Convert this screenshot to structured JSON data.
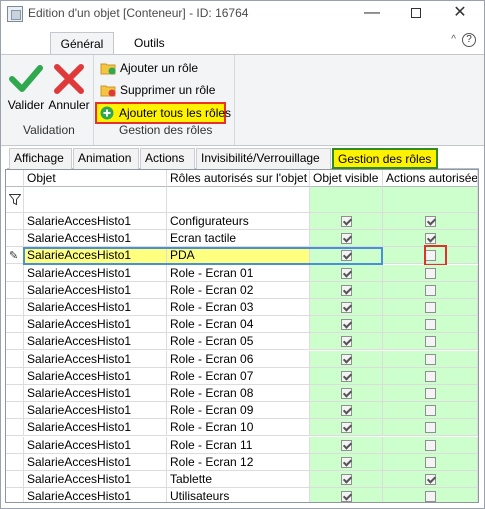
{
  "window": {
    "title": "Edition d'un objet [Conteneur] - ID: 16764",
    "controls": {
      "minimize": "—",
      "maximize": "",
      "close": "✕"
    }
  },
  "ribbon_tabs": {
    "general": "Général",
    "outils": "Outils"
  },
  "ribbon": {
    "validation": {
      "ok_label": "Valider",
      "cancel_label": "Annuler",
      "group_label": "Validation"
    },
    "roles": {
      "add_role": "Ajouter un rôle",
      "delete_role": "Supprimer un rôle",
      "add_all_roles": "Ajouter tous les rôles",
      "group_label": "Gestion des rôles"
    }
  },
  "sub_tabs": [
    {
      "label": "Affichage"
    },
    {
      "label": "Animation"
    },
    {
      "label": "Actions"
    },
    {
      "label": "Invisibilité/Verrouillage"
    },
    {
      "label": "Gestion des rôles"
    }
  ],
  "grid": {
    "headers": {
      "objet": "Objet",
      "roles": "Rôles autorisés sur l'objet",
      "visible": "Objet visible",
      "actions": "Actions autorisées"
    },
    "rows": [
      {
        "objet": "SalarieAccesHisto1",
        "role": "Configurateurs",
        "visible": true,
        "actions": true
      },
      {
        "objet": "SalarieAccesHisto1",
        "role": "Ecran tactile",
        "visible": true,
        "actions": true
      },
      {
        "objet": "SalarieAccesHisto1",
        "role": "PDA",
        "visible": true,
        "actions": false,
        "selected": true
      },
      {
        "objet": "SalarieAccesHisto1",
        "role": "Role - Ecran 01",
        "visible": true,
        "actions": false
      },
      {
        "objet": "SalarieAccesHisto1",
        "role": "Role - Ecran 02",
        "visible": true,
        "actions": false
      },
      {
        "objet": "SalarieAccesHisto1",
        "role": "Role - Ecran 03",
        "visible": true,
        "actions": false
      },
      {
        "objet": "SalarieAccesHisto1",
        "role": "Role - Ecran 04",
        "visible": true,
        "actions": false
      },
      {
        "objet": "SalarieAccesHisto1",
        "role": "Role - Ecran 05",
        "visible": true,
        "actions": false
      },
      {
        "objet": "SalarieAccesHisto1",
        "role": "Role - Ecran 06",
        "visible": true,
        "actions": false
      },
      {
        "objet": "SalarieAccesHisto1",
        "role": "Role - Ecran 07",
        "visible": true,
        "actions": false
      },
      {
        "objet": "SalarieAccesHisto1",
        "role": "Role - Ecran 08",
        "visible": true,
        "actions": false
      },
      {
        "objet": "SalarieAccesHisto1",
        "role": "Role - Ecran 09",
        "visible": true,
        "actions": false
      },
      {
        "objet": "SalarieAccesHisto1",
        "role": "Role - Ecran 10",
        "visible": true,
        "actions": false
      },
      {
        "objet": "SalarieAccesHisto1",
        "role": "Role - Ecran 11",
        "visible": true,
        "actions": false
      },
      {
        "objet": "SalarieAccesHisto1",
        "role": "Role - Ecran 12",
        "visible": true,
        "actions": false
      },
      {
        "objet": "SalarieAccesHisto1",
        "role": "Tablette",
        "visible": true,
        "actions": true
      },
      {
        "objet": "SalarieAccesHisto1",
        "role": "Utilisateurs",
        "visible": true,
        "actions": false
      }
    ]
  },
  "colors": {
    "permission_column": "#ccffcc",
    "highlight": "#fff200",
    "selection_frame": "#4a90d9",
    "alert_frame": "#e03030",
    "active_tab_frame": "#2e8b22"
  }
}
